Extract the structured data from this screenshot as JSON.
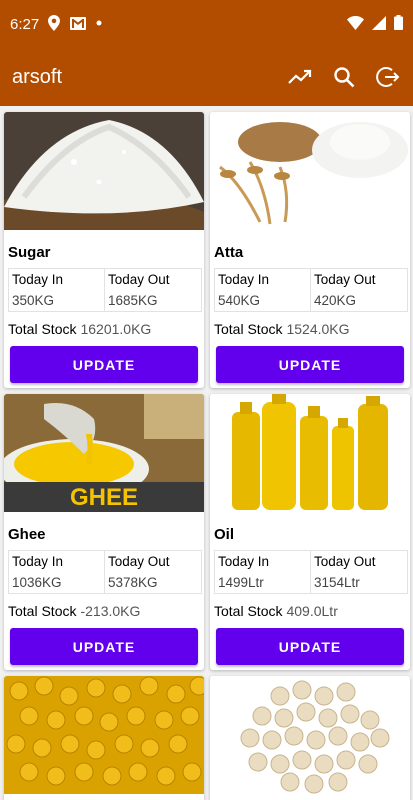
{
  "status": {
    "time": "6:27"
  },
  "appbar": {
    "title": "arsoft",
    "actions": [
      "chart-icon",
      "search-icon",
      "logout-icon"
    ]
  },
  "labels": {
    "today_in": "Today In",
    "today_out": "Today Out",
    "total_stock": "Total Stock",
    "update": "UPDATE"
  },
  "products": [
    {
      "name": "Sugar",
      "today_in": "350KG",
      "today_out": "1685KG",
      "total_stock": "16201.0KG",
      "image": "sugar-image"
    },
    {
      "name": "Atta",
      "today_in": "540KG",
      "today_out": "420KG",
      "total_stock": "1524.0KG",
      "image": "atta-image"
    },
    {
      "name": "Ghee",
      "today_in": "1036KG",
      "today_out": "5378KG",
      "total_stock": "-213.0KG",
      "image": "ghee-image",
      "image_text": "GHEE"
    },
    {
      "name": "Oil",
      "today_in": "1499Ltr",
      "today_out": "3154Ltr",
      "total_stock": "409.0Ltr",
      "image": "oil-image"
    },
    {
      "name": "",
      "image": "chana-dal-image"
    },
    {
      "name": "",
      "image": "chickpea-image"
    }
  ],
  "colors": {
    "appbar": "#b24d00",
    "button": "#6200ee"
  }
}
